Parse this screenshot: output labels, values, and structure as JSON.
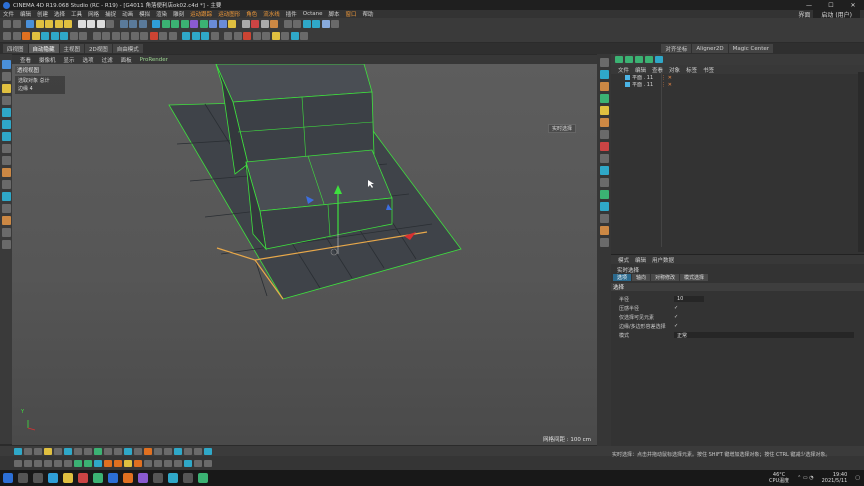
{
  "window": {
    "title": "CINEMA 4D R19.068 Studio (RC - R19) - [G4011 角落便利店ok02.c4d *] - 主要",
    "controls": [
      "—",
      "☐",
      "✕"
    ]
  },
  "menu": {
    "items": [
      "文件",
      "编辑",
      "创建",
      "选择",
      "工具",
      "网格",
      "捕捉",
      "动画",
      "模拟",
      "渲染",
      "雕刻",
      "运动跟踪",
      "运动图形",
      "角色",
      "流水线",
      "插件",
      "Octane",
      "脚本",
      "窗口",
      "帮助"
    ],
    "layout_label": "界面",
    "layout_value": "启动 (用户)"
  },
  "toolbar3": {
    "tabs": [
      "四视图",
      "自动隐藏",
      "主视图",
      "2D视图",
      "自由模式"
    ],
    "right_tabs": [
      "对齐坐标",
      "Aligner2D",
      "Magic Center"
    ]
  },
  "viewport_menu": {
    "items": [
      "查看",
      "摄像机",
      "显示",
      "选项",
      "过滤",
      "面板"
    ],
    "renderer": "ProRender"
  },
  "viewport": {
    "label": "透视视图",
    "info_lines": [
      "选取对象 总计",
      "边缘 4"
    ],
    "grid_spacing": "网格间距 : 100 cm",
    "tooltip": "实时选择",
    "axis_label": "Y"
  },
  "object_manager": {
    "menu": [
      "文件",
      "编辑",
      "查看",
      "对象",
      "标签",
      "书签"
    ],
    "objects": [
      {
        "name": "平面 . 11",
        "flags": "⋮ ✕"
      },
      {
        "name": "平面 . 11",
        "flags": "⋮ ✕"
      }
    ]
  },
  "attribute_manager": {
    "menu": [
      "模式",
      "编辑",
      "用户数据"
    ],
    "tool_title": "实时选择",
    "tabs": [
      "选项",
      "轴向",
      "对称修改",
      "模式选择"
    ],
    "section": "选择",
    "rows": [
      {
        "label": "半径",
        "value": "10"
      },
      {
        "label": "压感半径",
        "value": "✓"
      },
      {
        "label": "仅选择可见元素",
        "value": "✓"
      },
      {
        "label": "边缘/多边形容差选择",
        "value": "✓"
      },
      {
        "label": "模式",
        "value": "正常"
      }
    ]
  },
  "status_bar": {
    "text": "实时选择：点击并拖动鼠标选择元素。按住 SHIFT 键增加选择对象；按住 CTRL 键减少选择对象。"
  },
  "tray": {
    "temperature": "46°C",
    "cpu": "CPU温度",
    "time": "19:40",
    "date": "2021/5/11"
  },
  "colors": {
    "mesh_fill": "#3f4349",
    "mesh_edge": "#3ee03e",
    "selected_edge": "#e8a84a",
    "accent": "#2c6fd6"
  }
}
